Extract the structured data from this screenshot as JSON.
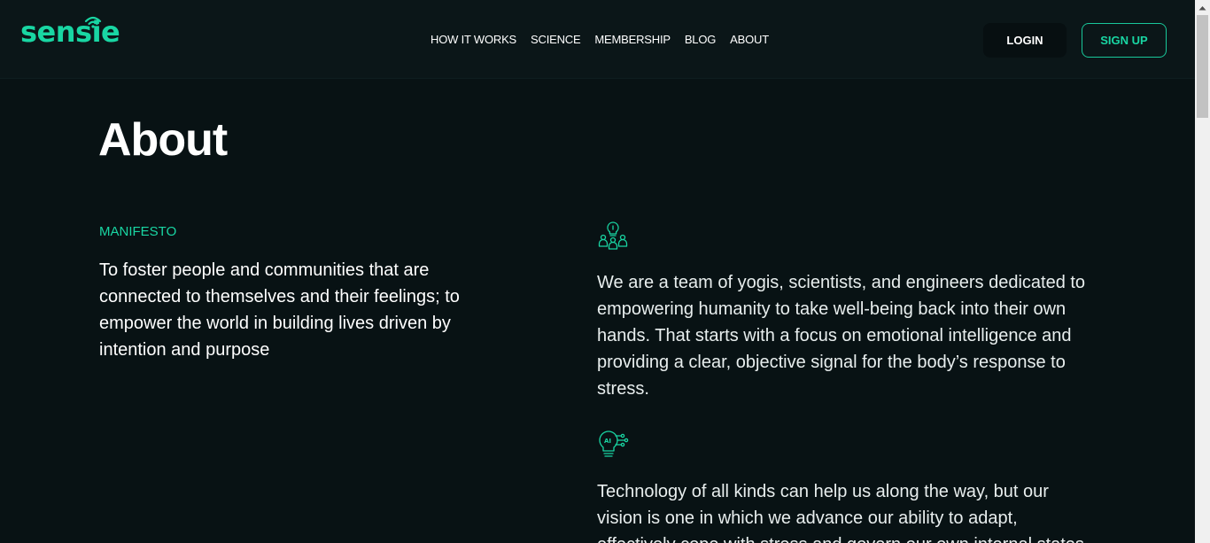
{
  "header": {
    "logo": "sensie",
    "nav": [
      "HOW IT WORKS",
      "SCIENCE",
      "MEMBERSHIP",
      "BLOG",
      "ABOUT"
    ],
    "login_label": "LOGIN",
    "signup_label": "SIGN UP"
  },
  "main": {
    "title": "About",
    "section_label": "MANIFESTO",
    "manifesto": "To foster people and communities that are connected to themselves and their feelings; to empower the world in building lives driven by intention and purpose",
    "paragraphs": [
      "We are a team of yogis, scientists, and engineers dedicated to empowering humanity to take well-being back into their own hands. That starts with a focus on emotional intelligence and providing a clear, objective signal for the body’s response to stress.",
      "Technology of all kinds can help us along the way, but our vision is one in which we advance our ability to adapt, effectively cope with stress and govern our own internal states."
    ],
    "icons": [
      "team-lightbulb-icon",
      "ai-lightbulb-icon"
    ]
  },
  "colors": {
    "accent": "#19d6a3",
    "background": "#081214",
    "header_bg": "#0b1618"
  }
}
